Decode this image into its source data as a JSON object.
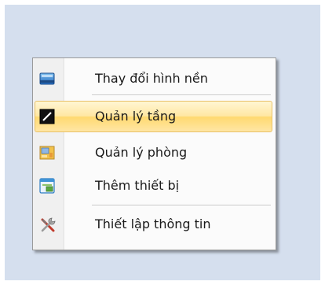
{
  "context_menu": {
    "items": [
      {
        "label": "Thay đổi hình nền",
        "icon": "wallpaper-icon"
      },
      {
        "label": "Quản lý tầng",
        "icon": "floor-icon"
      },
      {
        "label": "Quản lý phòng",
        "icon": "room-icon"
      },
      {
        "label": "Thêm thiết bị",
        "icon": "add-device-icon"
      },
      {
        "label": "Thiết lập thông tin",
        "icon": "tools-icon"
      }
    ],
    "highlighted_index": 1,
    "colors": {
      "highlight_top": "#fff6d3",
      "highlight_bottom": "#ffd970",
      "highlight_border": "#e8c168",
      "background": "#d5dfee"
    }
  }
}
